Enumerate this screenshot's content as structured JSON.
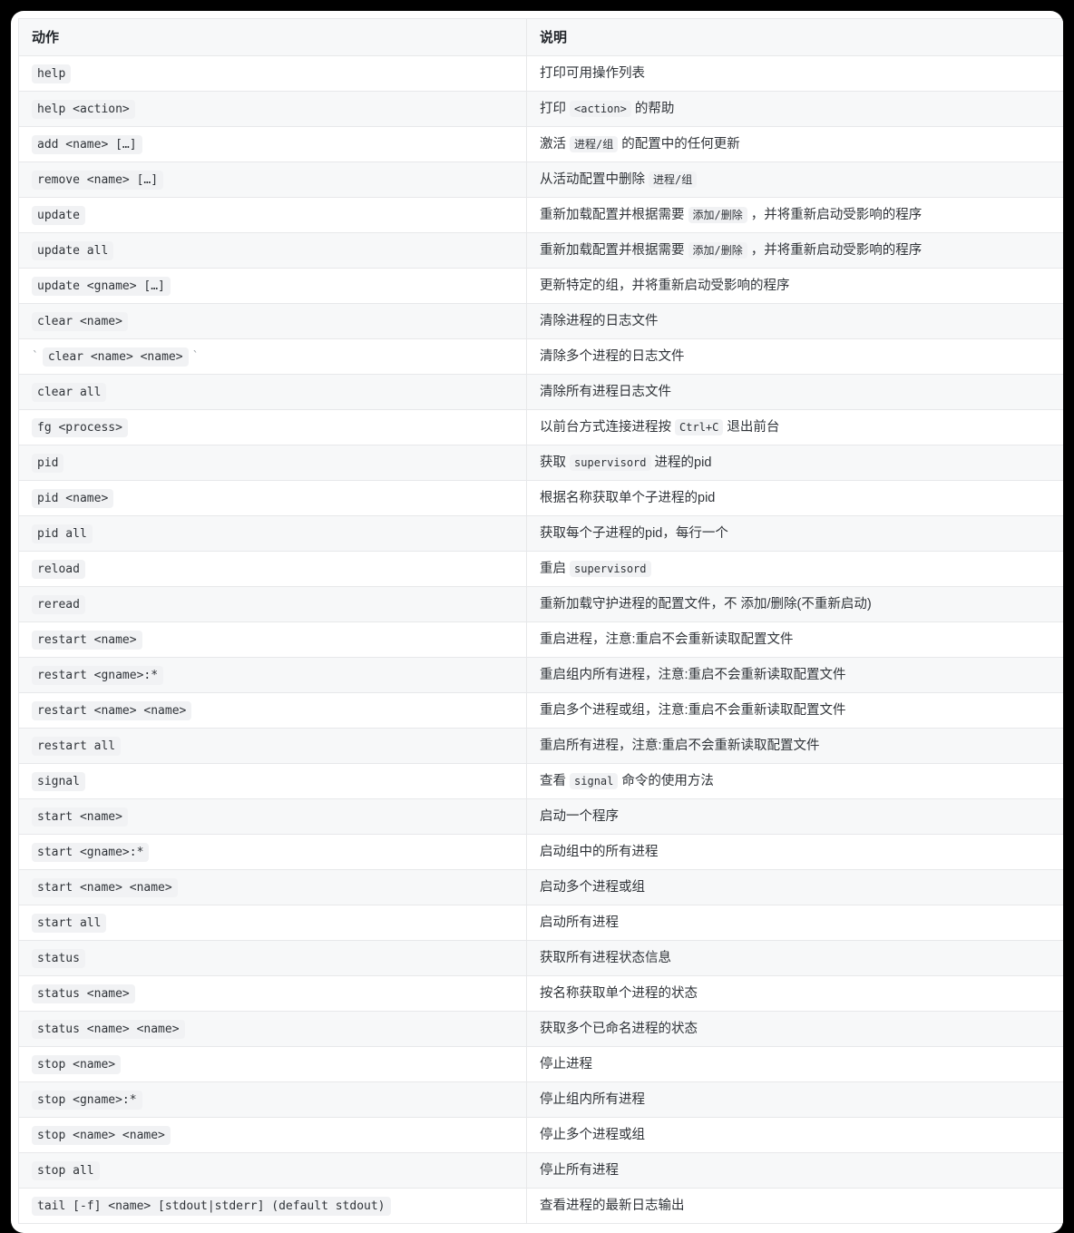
{
  "table": {
    "columns": [
      {
        "key": "action",
        "label": "动作"
      },
      {
        "key": "desc",
        "label": "说明"
      }
    ],
    "rows": [
      {
        "action_code": "help",
        "desc_parts": [
          {
            "t": "text",
            "v": "打印可用操作列表"
          }
        ]
      },
      {
        "action_code": "help <action>",
        "desc_parts": [
          {
            "t": "text",
            "v": "打印 "
          },
          {
            "t": "code",
            "v": "<action>"
          },
          {
            "t": "text",
            "v": " 的帮助"
          }
        ]
      },
      {
        "action_code": "add <name> […]",
        "desc_parts": [
          {
            "t": "text",
            "v": "激活 "
          },
          {
            "t": "code",
            "v": "进程/组"
          },
          {
            "t": "text",
            "v": " 的配置中的任何更新"
          }
        ]
      },
      {
        "action_code": "remove <name> […]",
        "desc_parts": [
          {
            "t": "text",
            "v": "从活动配置中删除 "
          },
          {
            "t": "code",
            "v": "进程/组"
          }
        ]
      },
      {
        "action_code": "update",
        "desc_parts": [
          {
            "t": "text",
            "v": "重新加载配置并根据需要 "
          },
          {
            "t": "code",
            "v": "添加/删除"
          },
          {
            "t": "text",
            "v": " ，并将重新启动受影响的程序"
          }
        ]
      },
      {
        "action_code": "update all",
        "desc_parts": [
          {
            "t": "text",
            "v": "重新加载配置并根据需要 "
          },
          {
            "t": "code",
            "v": "添加/删除"
          },
          {
            "t": "text",
            "v": " ，并将重新启动受影响的程序"
          }
        ]
      },
      {
        "action_code": "update <gname> […]",
        "desc_parts": [
          {
            "t": "text",
            "v": "更新特定的组，并将重新启动受影响的程序"
          }
        ]
      },
      {
        "action_code": "clear <name>",
        "desc_parts": [
          {
            "t": "text",
            "v": "清除进程的日志文件"
          }
        ]
      },
      {
        "action_prefix_tick": "`",
        "action_code": "clear <name> <name>",
        "action_suffix_tick": "`",
        "desc_parts": [
          {
            "t": "text",
            "v": "清除多个进程的日志文件"
          }
        ]
      },
      {
        "action_code": "clear all",
        "desc_parts": [
          {
            "t": "text",
            "v": "清除所有进程日志文件"
          }
        ]
      },
      {
        "action_code": "fg <process>",
        "desc_parts": [
          {
            "t": "text",
            "v": "以前台方式连接进程按 "
          },
          {
            "t": "code",
            "v": "Ctrl+C"
          },
          {
            "t": "text",
            "v": " 退出前台"
          }
        ]
      },
      {
        "action_code": "pid",
        "desc_parts": [
          {
            "t": "text",
            "v": "获取 "
          },
          {
            "t": "code",
            "v": "supervisord"
          },
          {
            "t": "text",
            "v": " 进程的pid"
          }
        ]
      },
      {
        "action_code": "pid <name>",
        "desc_parts": [
          {
            "t": "text",
            "v": "根据名称获取单个子进程的pid"
          }
        ]
      },
      {
        "action_code": "pid all",
        "desc_parts": [
          {
            "t": "text",
            "v": "获取每个子进程的pid，每行一个"
          }
        ]
      },
      {
        "action_code": "reload",
        "desc_parts": [
          {
            "t": "text",
            "v": "重启 "
          },
          {
            "t": "code",
            "v": "supervisord"
          }
        ]
      },
      {
        "action_code": "reread",
        "desc_parts": [
          {
            "t": "text",
            "v": "重新加载守护进程的配置文件，不 添加/删除(不重新启动)"
          }
        ]
      },
      {
        "action_code": "restart <name>",
        "desc_parts": [
          {
            "t": "text",
            "v": "重启进程，注意:重启不会重新读取配置文件"
          }
        ]
      },
      {
        "action_code": "restart <gname>:*",
        "desc_parts": [
          {
            "t": "text",
            "v": "重启组内所有进程，注意:重启不会重新读取配置文件"
          }
        ]
      },
      {
        "action_code": "restart <name> <name>",
        "desc_parts": [
          {
            "t": "text",
            "v": "重启多个进程或组，注意:重启不会重新读取配置文件"
          }
        ]
      },
      {
        "action_code": "restart all",
        "desc_parts": [
          {
            "t": "text",
            "v": "重启所有进程，注意:重启不会重新读取配置文件"
          }
        ]
      },
      {
        "action_code": "signal",
        "desc_parts": [
          {
            "t": "text",
            "v": "查看 "
          },
          {
            "t": "code",
            "v": "signal"
          },
          {
            "t": "text",
            "v": " 命令的使用方法"
          }
        ]
      },
      {
        "action_code": "start <name>",
        "desc_parts": [
          {
            "t": "text",
            "v": "启动一个程序"
          }
        ]
      },
      {
        "action_code": "start <gname>:*",
        "desc_parts": [
          {
            "t": "text",
            "v": "启动组中的所有进程"
          }
        ]
      },
      {
        "action_code": "start <name> <name>",
        "desc_parts": [
          {
            "t": "text",
            "v": "启动多个进程或组"
          }
        ]
      },
      {
        "action_code": "start all",
        "desc_parts": [
          {
            "t": "text",
            "v": "启动所有进程"
          }
        ]
      },
      {
        "action_code": "status",
        "desc_parts": [
          {
            "t": "text",
            "v": "获取所有进程状态信息"
          }
        ]
      },
      {
        "action_code": "status <name>",
        "desc_parts": [
          {
            "t": "text",
            "v": "按名称获取单个进程的状态"
          }
        ]
      },
      {
        "action_code": "status <name> <name>",
        "desc_parts": [
          {
            "t": "text",
            "v": "获取多个已命名进程的状态"
          }
        ]
      },
      {
        "action_code": "stop <name>",
        "desc_parts": [
          {
            "t": "text",
            "v": "停止进程"
          }
        ]
      },
      {
        "action_code": "stop <gname>:*",
        "desc_parts": [
          {
            "t": "text",
            "v": "停止组内所有进程"
          }
        ]
      },
      {
        "action_code": "stop <name> <name>",
        "desc_parts": [
          {
            "t": "text",
            "v": "停止多个进程或组"
          }
        ]
      },
      {
        "action_code": "stop all",
        "desc_parts": [
          {
            "t": "text",
            "v": "停止所有进程"
          }
        ]
      },
      {
        "action_code": "tail [-f] <name> [stdout|stderr] (default stdout)",
        "desc_parts": [
          {
            "t": "text",
            "v": "查看进程的最新日志输出"
          }
        ]
      }
    ]
  },
  "colors": {
    "page_background": "#000000",
    "card_background": "#ffffff",
    "row_stripe": "#f7f8f9",
    "border": "#e7e8ea",
    "code_background": "#f1f2f4",
    "text": "#2f3338"
  }
}
